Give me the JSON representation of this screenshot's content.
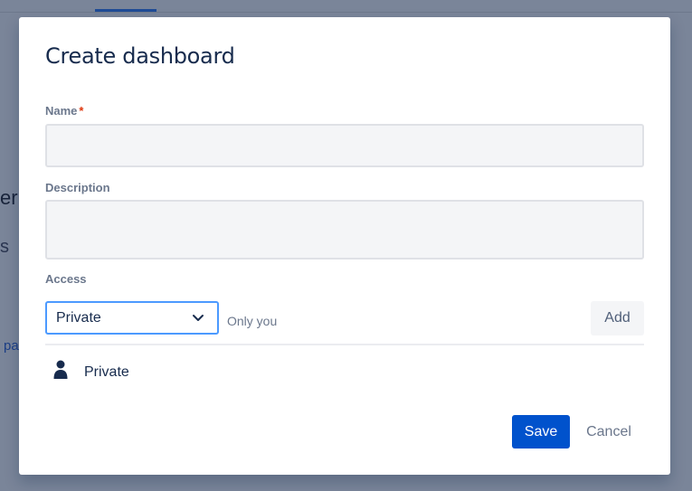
{
  "background": {
    "fragment_a": "er",
    "fragment_b": "s",
    "fragment_c": "pa"
  },
  "dialog": {
    "title": "Create dashboard",
    "name": {
      "label": "Name",
      "required_mark": "*",
      "value": ""
    },
    "description": {
      "label": "Description",
      "value": ""
    },
    "access": {
      "label": "Access",
      "selected": "Private",
      "hint": "Only you",
      "add_label": "Add",
      "entries": [
        {
          "icon": "person-icon",
          "label": "Private"
        }
      ]
    },
    "save_label": "Save",
    "cancel_label": "Cancel"
  },
  "colors": {
    "primary": "#0052cc",
    "focus_border": "#4c9aff",
    "required": "#de350b",
    "overlay": "#7a8599"
  }
}
